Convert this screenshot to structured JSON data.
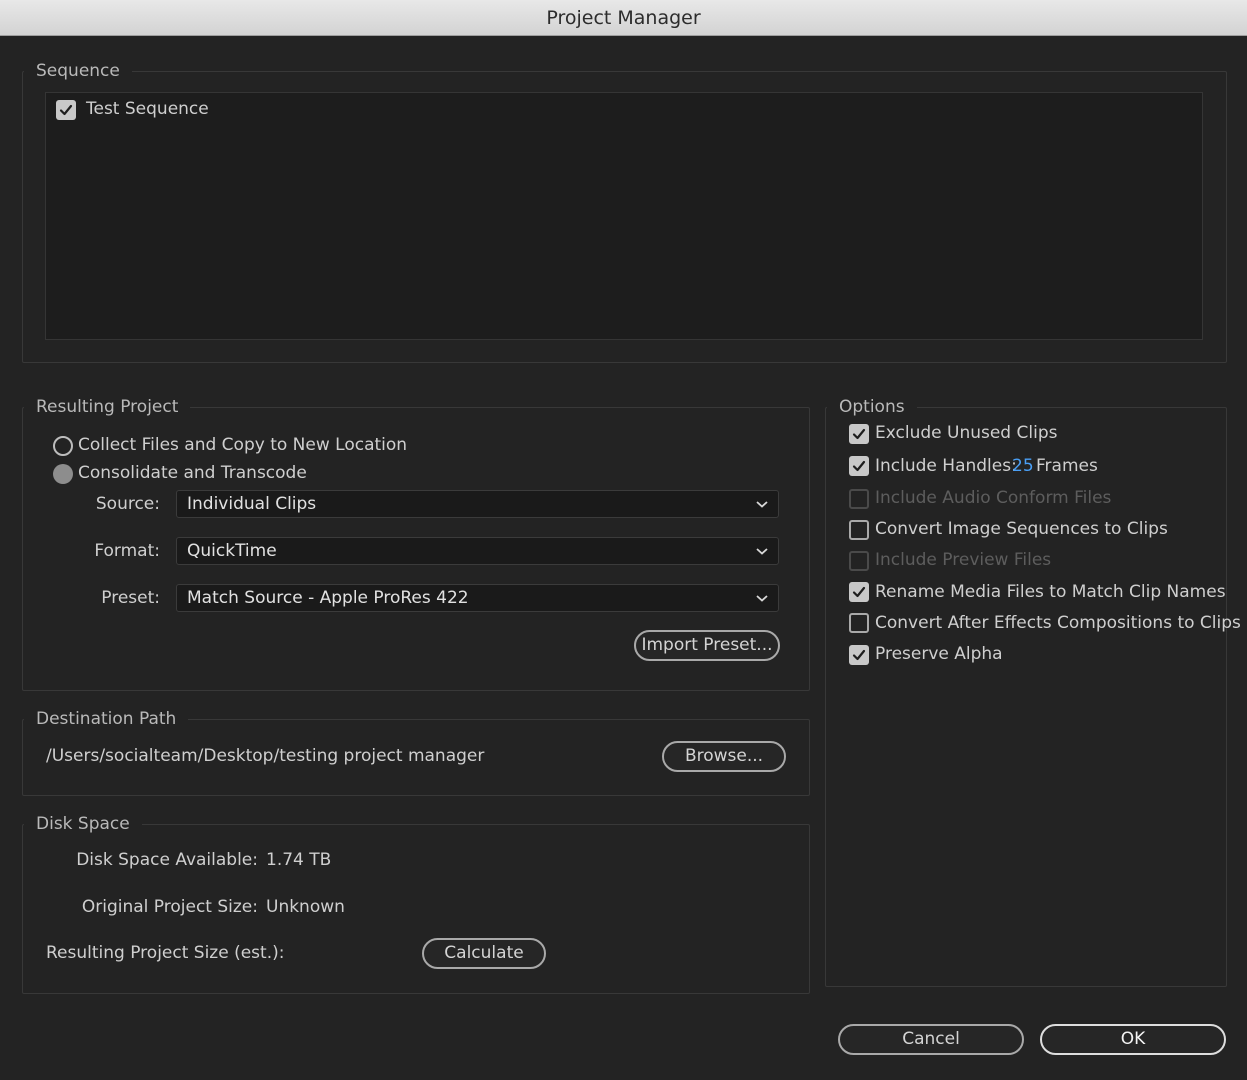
{
  "window": {
    "title": "Project Manager"
  },
  "sequence": {
    "legend": "Sequence",
    "items": [
      {
        "label": "Test Sequence",
        "checked": true
      }
    ]
  },
  "resulting_project": {
    "legend": "Resulting Project",
    "radio_collect": "Collect Files and Copy to New Location",
    "radio_consolidate": "Consolidate and Transcode",
    "source_label": "Source:",
    "source_value": "Individual Clips",
    "format_label": "Format:",
    "format_value": "QuickTime",
    "preset_label": "Preset:",
    "preset_value": "Match Source - Apple ProRes 422",
    "import_preset_button": "Import Preset..."
  },
  "destination": {
    "legend": "Destination Path",
    "path": "/Users/socialteam/Desktop/testing project manager",
    "browse_button": "Browse..."
  },
  "disk_space": {
    "legend": "Disk Space",
    "available_label": "Disk Space Available:",
    "available_value": "1.74 TB",
    "original_label": "Original Project Size:",
    "original_value": "Unknown",
    "resulting_label": "Resulting Project Size (est.):",
    "calculate_button": "Calculate"
  },
  "options": {
    "legend": "Options",
    "exclude_unused": "Exclude Unused Clips",
    "include_handles": "Include Handles:",
    "handles_value": "25",
    "handles_unit": "Frames",
    "include_audio_conform": "Include Audio Conform Files",
    "convert_image_sequences": "Convert Image Sequences to Clips",
    "include_preview": "Include Preview Files",
    "rename_media": "Rename Media Files to Match Clip Names",
    "convert_ae": "Convert After Effects Compositions to Clips",
    "preserve_alpha": "Preserve Alpha"
  },
  "footer": {
    "cancel": "Cancel",
    "ok": "OK"
  },
  "colors": {
    "background": "#232323",
    "accent": "#4a9ff5",
    "titlebar": "#dcdcdc"
  }
}
